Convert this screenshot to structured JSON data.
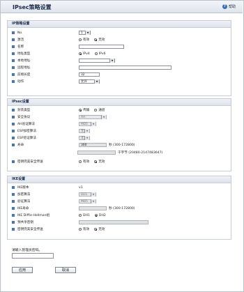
{
  "title": "IPsec策略设置",
  "help": "帮助",
  "sec_ip": {
    "header": "IP策略设置",
    "no": {
      "label": "No.",
      "value": "1"
    },
    "state": {
      "label": "激活",
      "options": [
        "有效",
        "无效"
      ],
      "selected": "无效"
    },
    "name": {
      "label": "名称",
      "value": ""
    },
    "addr_type": {
      "label": "地址类型",
      "options": [
        "IPv4",
        "IPv6"
      ],
      "selected": "IPv4"
    },
    "local": {
      "label": "本地地址",
      "value": ""
    },
    "remote": {
      "label": "远程地址",
      "value": ""
    },
    "prefix": {
      "label": "前缀长度",
      "value": "32"
    },
    "action": {
      "label": "动作",
      "value": "允许"
    }
  },
  "sec_ipsec": {
    "header": "IPsec设置",
    "enc_type": {
      "label": "封装类型",
      "options": [
        "传输",
        "通道"
      ],
      "selected": "传输"
    },
    "protocol": {
      "label": "安全协议",
      "value": "AH"
    },
    "ah_auth": {
      "label": "AH验证算法",
      "value": "MD5"
    },
    "esp_enc": {
      "label": "ESP加密算法",
      "value": "无"
    },
    "esp_auth": {
      "label": "ESP验证算法",
      "value": "无"
    },
    "lifetime": {
      "label": "寿命",
      "value1": "300",
      "unit1": "秒 (300-172800)",
      "value2": "",
      "unit2": "千字节 (20480-2147483647)"
    },
    "pfs": {
      "label": "密钥完美安全传送",
      "options": [
        "有效",
        "无效"
      ],
      "selected": "无效"
    }
  },
  "sec_ike": {
    "header": "IKE设置",
    "version": {
      "label": "IKE版本",
      "value": "v1"
    },
    "enc": {
      "label": "加密算法",
      "value": "DES"
    },
    "auth": {
      "label": "验证算法",
      "value": "MD5"
    },
    "lifetime": {
      "label": "IKE寿命",
      "value": "",
      "unit": "秒 (300-172800)"
    },
    "dh": {
      "label": "IKE Diffie-Hellman组",
      "options": [
        "DH1",
        "DH2"
      ],
      "selected": "DH2"
    },
    "psk": {
      "label": "预共享密钥",
      "value": ""
    },
    "pfs": {
      "label": "密钥完美安全传送",
      "options": [
        "有效",
        "无效"
      ],
      "selected": "无效"
    }
  },
  "password_prompt": "请输入管理员密码。",
  "buttons": {
    "apply": "应用",
    "cancel": "取消"
  }
}
